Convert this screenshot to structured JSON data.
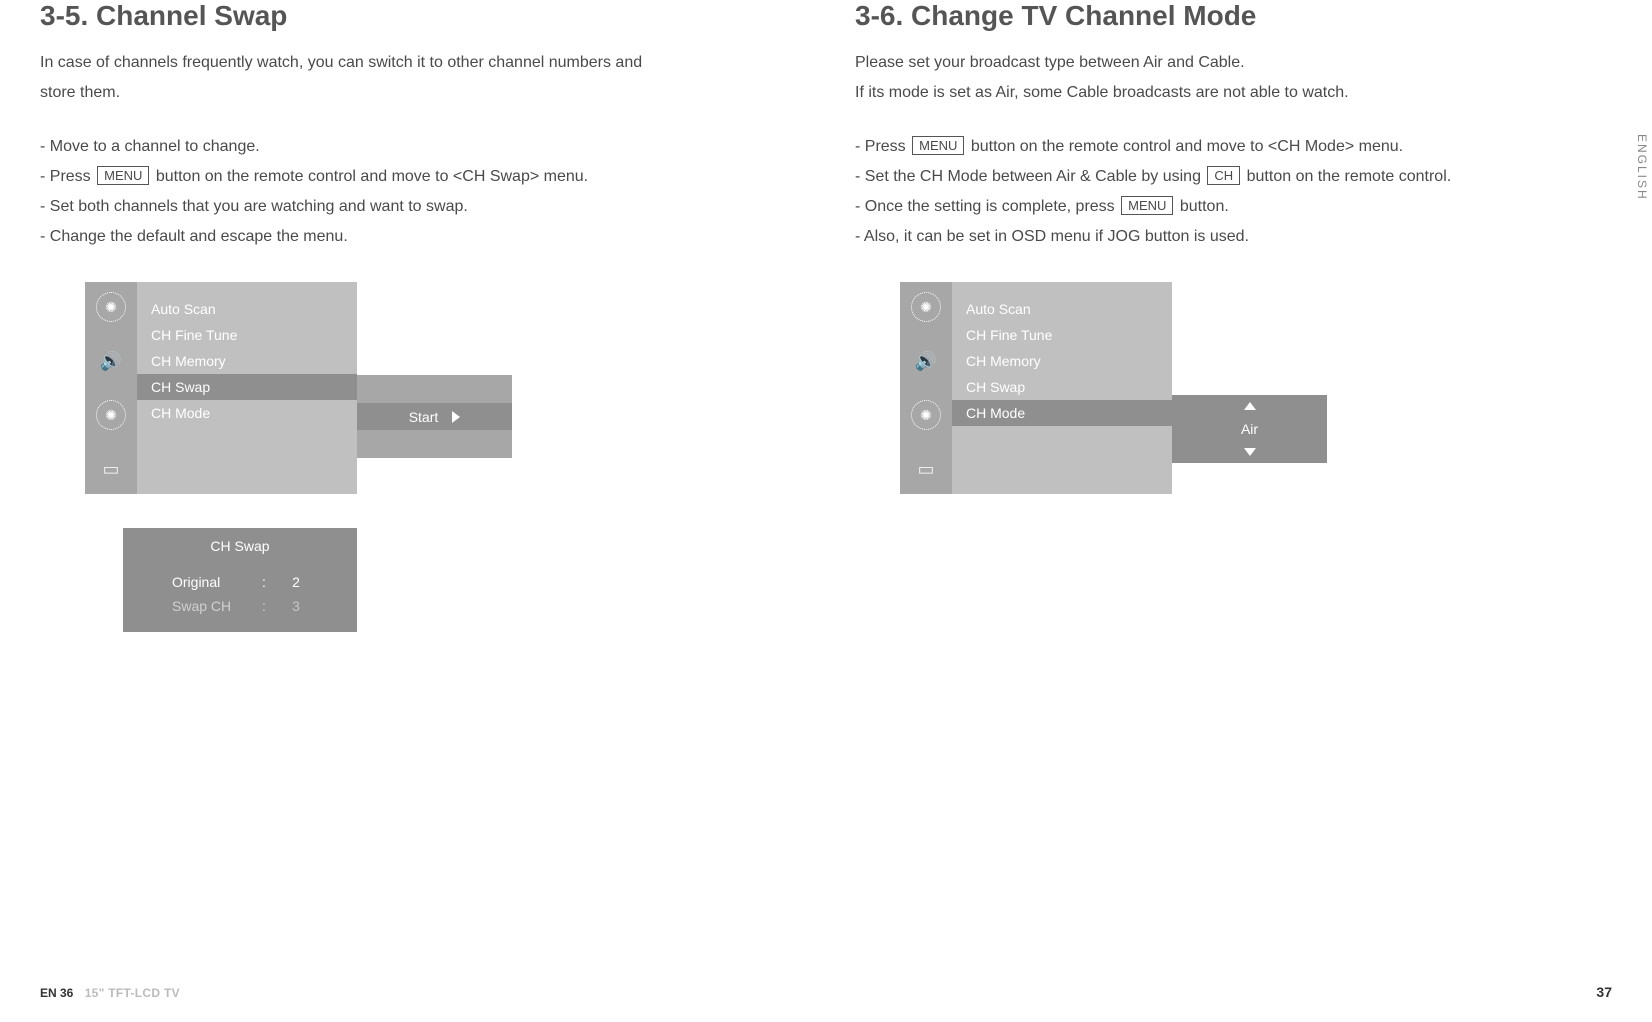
{
  "sideTab": "ENGLISH",
  "left": {
    "title": "3-5. Channel Swap",
    "p1a": "In case of channels frequently watch, you can switch it to other channel numbers and",
    "p1b": "store them.",
    "s1": "- Move to a channel to change.",
    "s2a": "- Press ",
    "s2btn": "MENU",
    "s2b": " button on the remote control and move to <CH Swap> menu.",
    "s3": "- Set both channels that you are watching and want to swap.",
    "s4": "- Change the default and escape the menu.",
    "osd": {
      "items": [
        "Auto Scan",
        "CH Fine Tune",
        "CH Memory",
        "CH Swap",
        "CH Mode"
      ],
      "selectedIndex": 3,
      "value": "Start"
    },
    "swap": {
      "title": "CH Swap",
      "row1k": "Original",
      "row1v": "2",
      "row2k": "Swap CH",
      "row2v": "3"
    }
  },
  "right": {
    "title": "3-6. Change TV Channel Mode",
    "p1": "Please set your broadcast type between Air and Cable.",
    "p2": "If its mode is set as Air, some Cable broadcasts are not able to watch.",
    "s1a": "- Press ",
    "s1btn": "MENU",
    "s1b": " button on the remote control and move to <CH Mode> menu.",
    "s2a": "- Set the CH Mode between Air & Cable by using ",
    "s2btn": "CH",
    "s2b": " button on the remote control.",
    "s3a": "- Once the setting is complete, press ",
    "s3btn": "MENU",
    "s3b": " button.",
    "s4": "- Also, it can be set in OSD menu if JOG button is used.",
    "osd": {
      "items": [
        "Auto Scan",
        "CH Fine Tune",
        "CH Memory",
        "CH Swap",
        "CH Mode"
      ],
      "selectedIndex": 4,
      "value": "Air"
    }
  },
  "footer": {
    "leftPage": "EN 36",
    "prod": "15\" TFT-LCD TV",
    "rightPage": "37"
  }
}
